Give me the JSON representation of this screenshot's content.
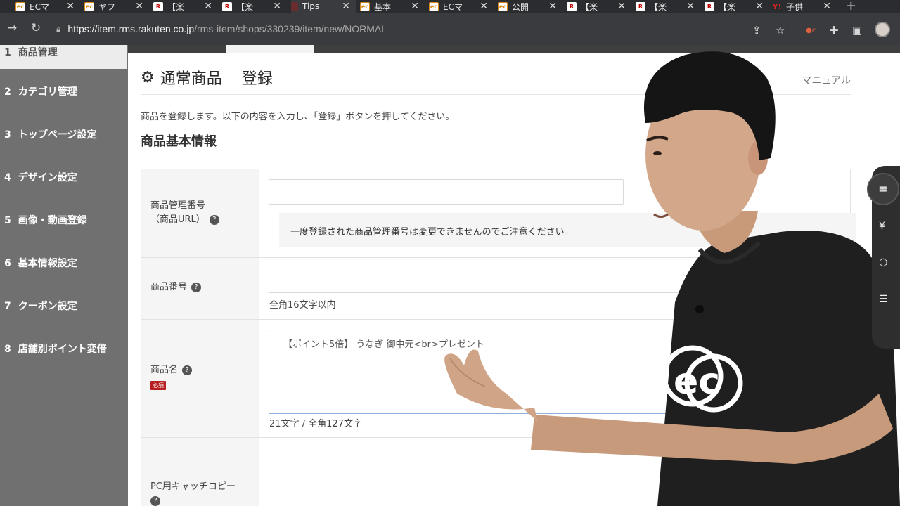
{
  "browser": {
    "tabs": [
      {
        "label": "ECマ",
        "icon": "ec-favicon"
      },
      {
        "label": "ヤフ",
        "icon": "ec-favicon"
      },
      {
        "label": "【楽",
        "icon": "rakuten-favicon"
      },
      {
        "label": "【楽",
        "icon": "rakuten-favicon"
      },
      {
        "label": "Tips",
        "icon": "tips-favicon"
      },
      {
        "label": "基本",
        "icon": "ec-favicon"
      },
      {
        "label": "ECマ",
        "icon": "ec-favicon"
      },
      {
        "label": "公開",
        "icon": "ec-favicon"
      },
      {
        "label": "【楽",
        "icon": "rakuten-favicon"
      },
      {
        "label": "【楽",
        "icon": "rakuten-favicon"
      },
      {
        "label": "【楽",
        "icon": "rakuten-favicon"
      },
      {
        "label": "子供",
        "icon": "yahoo-favicon"
      }
    ],
    "url_host": "https://item.rms.rakuten.co.jp",
    "url_path": "/rms-item/shops/330239/item/new/NORMAL"
  },
  "sidebar": {
    "items": [
      {
        "num": "1",
        "label": "商品管理"
      },
      {
        "num": "2",
        "label": "カテゴリ管理"
      },
      {
        "num": "3",
        "label": "トップページ設定"
      },
      {
        "num": "4",
        "label": "デザイン設定"
      },
      {
        "num": "5",
        "label": "画像・動画登録"
      },
      {
        "num": "6",
        "label": "基本情報設定"
      },
      {
        "num": "7",
        "label": "クーポン設定"
      },
      {
        "num": "8",
        "label": "店舗別ポイント変倍"
      }
    ]
  },
  "page": {
    "title_part1": "通常商品",
    "title_part2": "登録",
    "manual_link": "マニュアル",
    "description": "商品を登録します。以下の内容を入力し、「登録」ボタンを押してください。",
    "section_title": "商品基本情報"
  },
  "form": {
    "item_code": {
      "label_line1": "商品管理番号",
      "label_line2": "（商品URL）",
      "value": "",
      "note": "一度登録された商品管理番号は変更できませんのでご注意ください。"
    },
    "item_number": {
      "label": "商品番号",
      "value": "",
      "hint": "全角16文字以内"
    },
    "item_name": {
      "label": "商品名",
      "required_badge": "必須",
      "value": "【ポイント5倍】 うなぎ 御中元<br>プレゼント",
      "counter": "21文字 / 全角127文字"
    },
    "pc_catch_copy": {
      "label": "PC用キャッチコピー",
      "value": ""
    }
  },
  "colors": {
    "sidebar_bg": "#6f706f",
    "required_badge": "#b72020",
    "browser_chrome": "#3a3b3e"
  }
}
